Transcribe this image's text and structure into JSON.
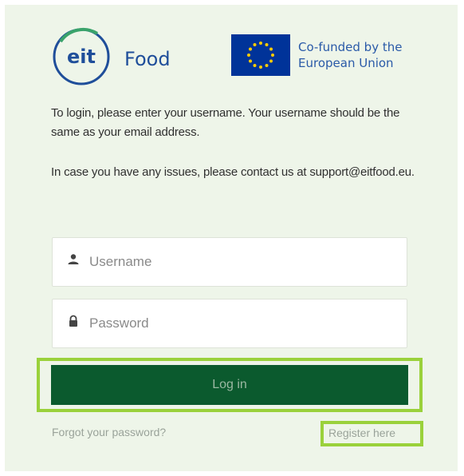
{
  "header": {
    "eit_logo_text": "eit",
    "eit_logo_word": "Food",
    "eu_line1": "Co-funded by the",
    "eu_line2": "European Union"
  },
  "info": {
    "paragraph1": "To login, please enter your username. Your username should be the same as your email address.",
    "paragraph2": "In case you have any issues, please contact us at support@eitfood.eu."
  },
  "form": {
    "username_placeholder": "Username",
    "username_value": "",
    "password_placeholder": "Password",
    "password_value": "",
    "login_label": "Log in",
    "forgot_label": "Forgot your password?",
    "register_label": "Register here"
  },
  "colors": {
    "background": "#eef5e9",
    "eit_blue": "#1f4e9a",
    "eit_green": "#3aa36b",
    "eu_blue": "#003399",
    "eu_star": "#ffcc00",
    "button": "#0b5a2e",
    "highlight": "#9ad13b"
  },
  "icons": {
    "username": "user-icon",
    "password": "lock-icon"
  }
}
